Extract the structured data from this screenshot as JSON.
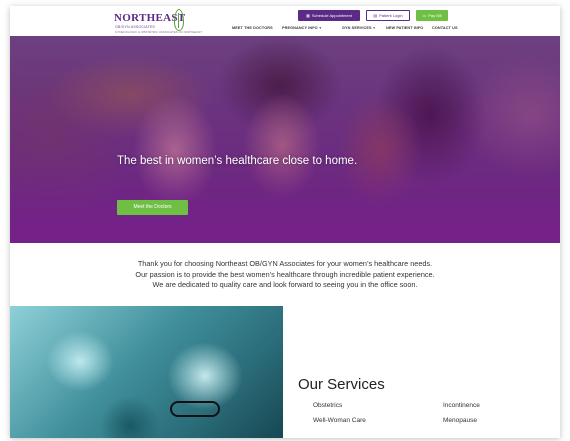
{
  "header": {
    "logo_name": "NORTHEAST",
    "logo_sub": "OB/GYN ASSOCIATES",
    "logo_tagline": "GYNECOLOGIC & OBSTETRIC ASSOCIATES OF NORTHEAST",
    "schedule_label": "Schedule Appointment",
    "portal_label": "Patient Login",
    "pay_label": "Pay Bill",
    "nav": [
      {
        "label": "MEET THE DOCTORS"
      },
      {
        "label": "PREGNANCY INFO"
      },
      {
        "label": "GYN SERVICES"
      },
      {
        "label": "NEW PATIENT INFO"
      },
      {
        "label": "CONTACT US"
      }
    ]
  },
  "hero": {
    "title": "The best in women’s healthcare close to home.",
    "button_label": "Meet the Doctors"
  },
  "intro": {
    "lines": [
      "Thank you for choosing Northeast OB/GYN Associates for your women’s healthcare needs.",
      "Our passion is to provide the best women’s healthcare through incredible patient experience.",
      "We are dedicated to quality care and look forward to seeing you in the office soon."
    ]
  },
  "services": {
    "title": "Our Services",
    "items": [
      "Obstetrics",
      "Incontinence",
      "Well-Woman Care",
      "Menopause"
    ]
  },
  "colors": {
    "brand_purple": "#5b2a86",
    "accent_green": "#6fbf44"
  }
}
